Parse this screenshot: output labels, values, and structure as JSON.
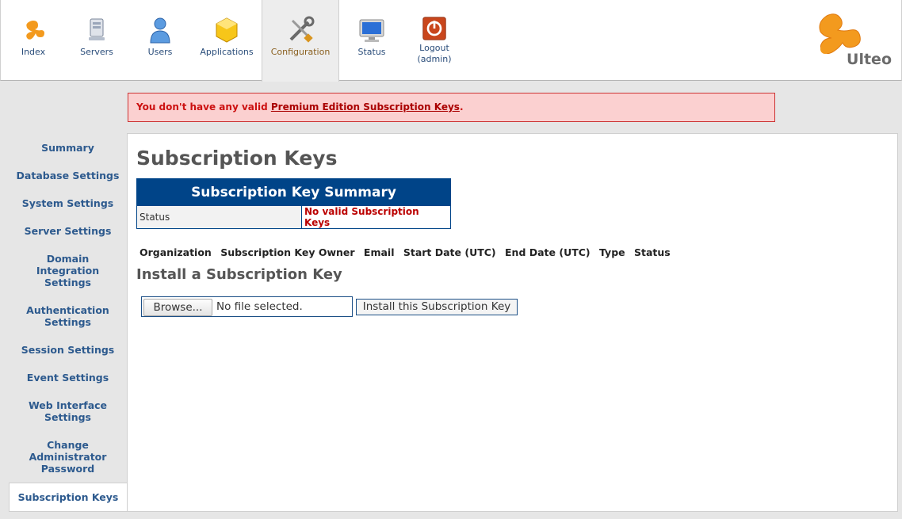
{
  "nav": {
    "items": [
      {
        "label": "Index",
        "icon": "index-icon"
      },
      {
        "label": "Servers",
        "icon": "servers-icon"
      },
      {
        "label": "Users",
        "icon": "users-icon"
      },
      {
        "label": "Applications",
        "icon": "applications-icon"
      },
      {
        "label": "Configuration",
        "icon": "configuration-icon",
        "active": true
      },
      {
        "label": "Status",
        "icon": "status-icon"
      },
      {
        "label": "Logout",
        "sublabel": "(admin)",
        "icon": "logout-icon"
      }
    ]
  },
  "logo": {
    "text": "Ulteo"
  },
  "warning": {
    "prefix": "You don't have any valid ",
    "link": "Premium Edition Subscription Keys",
    "suffix": "."
  },
  "sidebar": {
    "items": [
      {
        "label": "Summary"
      },
      {
        "label": "Database Settings"
      },
      {
        "label": "System Settings"
      },
      {
        "label": "Server Settings"
      },
      {
        "label": "Domain Integration Settings"
      },
      {
        "label": "Authentication Settings"
      },
      {
        "label": "Session Settings"
      },
      {
        "label": "Event Settings"
      },
      {
        "label": "Web Interface Settings"
      },
      {
        "label": "Change Administrator Password"
      },
      {
        "label": "Subscription Keys",
        "active": true
      }
    ]
  },
  "main": {
    "title": "Subscription Keys",
    "summary": {
      "header": "Subscription Key Summary",
      "status_label": "Status",
      "status_value": "No valid Subscription Keys"
    },
    "keys_table": {
      "columns": [
        "Organization",
        "Subscription Key Owner",
        "Email",
        "Start Date (UTC)",
        "End Date (UTC)",
        "Type",
        "Status"
      ]
    },
    "install": {
      "title": "Install a Subscription Key",
      "browse_label": "Browse...",
      "file_status": "No file selected.",
      "submit_label": "Install this Subscription Key"
    }
  },
  "colors": {
    "accent_blue": "#004488",
    "error_red": "#cc1111",
    "brand_orange": "#f39a1e"
  }
}
